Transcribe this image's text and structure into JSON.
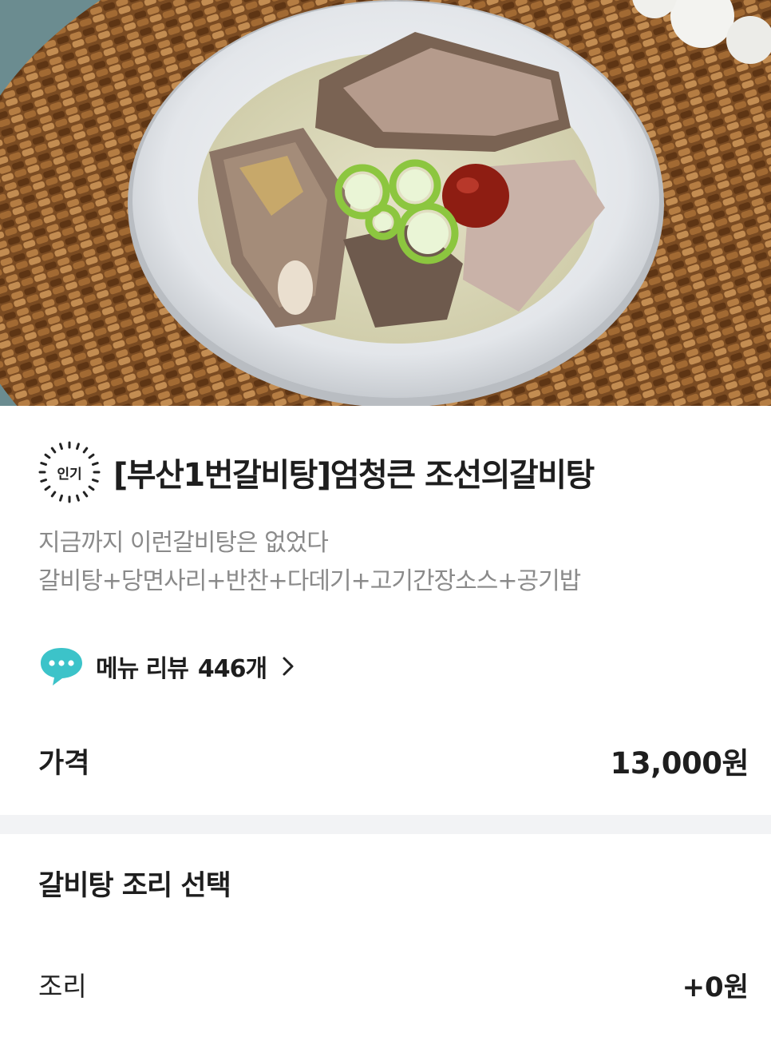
{
  "hero": {
    "image": "galbitang-soup-photo",
    "colors": {
      "mat": "#8a5a2e",
      "bowl": "#e9ecef",
      "broth": "#d9d6b8"
    }
  },
  "menu": {
    "badge": "인기",
    "title": "[부산1번갈비탕]엄청큰 조선의갈비탕",
    "description": [
      "지금까지 이런갈비탕은 없었다",
      "갈비탕+당면사리+반찬+다데기+고기간장소스+공기밥"
    ]
  },
  "review": {
    "icon": "chat-bubble-icon",
    "label": "메뉴 리뷰",
    "count": "446개",
    "chevron": "chevron-right-icon",
    "accent_color": "#3cc3c9"
  },
  "price": {
    "label": "가격",
    "value": "13,000원"
  },
  "options_section": {
    "title": "갈비탕 조리 선택",
    "items": [
      {
        "label": "조리",
        "price": "+0원"
      }
    ]
  }
}
